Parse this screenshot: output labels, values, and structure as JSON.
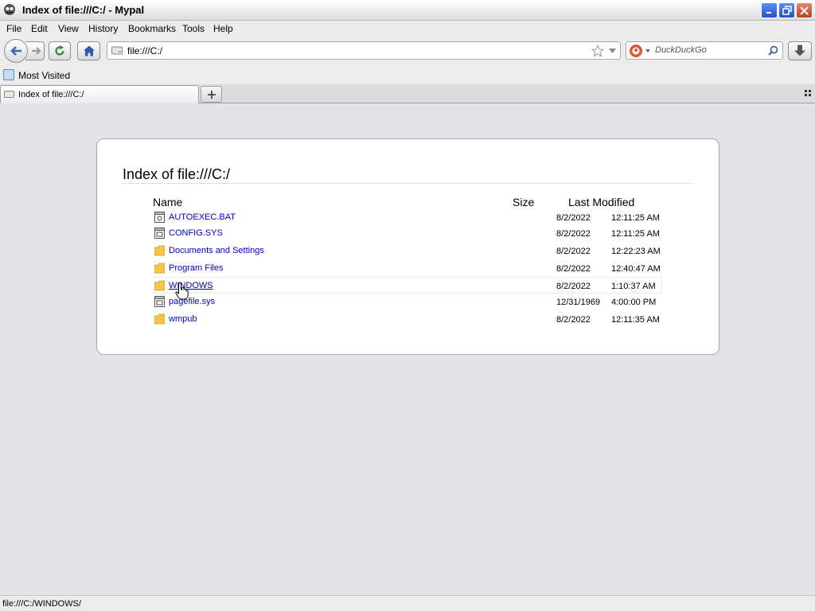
{
  "window": {
    "title": "Index of file:///C:/ - Mypal"
  },
  "menu": {
    "items": [
      "File",
      "Edit",
      "View",
      "History",
      "Bookmarks",
      "Tools",
      "Help"
    ]
  },
  "navbar": {
    "url": "file:///C:/",
    "search_placeholder": "DuckDuckGo"
  },
  "bookmarks": {
    "items": [
      "Most Visited"
    ]
  },
  "tabs": [
    {
      "label": "Index of file:///C:/",
      "active": true
    }
  ],
  "listing": {
    "title": "Index of file:///C:/",
    "headers": {
      "name": "Name",
      "size": "Size",
      "modified": "Last Modified"
    },
    "rows": [
      {
        "name": "AUTOEXEC.BAT",
        "icon": "bat-file-icon",
        "size": "",
        "date": "8/2/2022",
        "time": "12:11:25 AM"
      },
      {
        "name": "CONFIG.SYS",
        "icon": "sys-file-icon",
        "size": "",
        "date": "8/2/2022",
        "time": "12:11:25 AM"
      },
      {
        "name": "Documents and Settings",
        "icon": "folder-icon",
        "size": "",
        "date": "8/2/2022",
        "time": "12:22:23 AM"
      },
      {
        "name": "Program Files",
        "icon": "folder-icon",
        "size": "",
        "date": "8/2/2022",
        "time": "12:40:47 AM"
      },
      {
        "name": "WINDOWS",
        "icon": "folder-icon",
        "size": "",
        "date": "8/2/2022",
        "time": "1:10:37 AM",
        "hovered": true
      },
      {
        "name": "pagefile.sys",
        "icon": "sys-file-icon",
        "size": "",
        "date": "12/31/1969",
        "time": "4:00:00 PM"
      },
      {
        "name": "wmpub",
        "icon": "folder-icon",
        "size": "",
        "date": "8/2/2022",
        "time": "12:11:35 AM"
      }
    ]
  },
  "status": {
    "text": "file:///C:/WINDOWS/"
  },
  "colors": {
    "link": "#0000cc",
    "folder": "#f5c54a",
    "close_button": "#c1401e",
    "window_button": "#2452c8"
  }
}
